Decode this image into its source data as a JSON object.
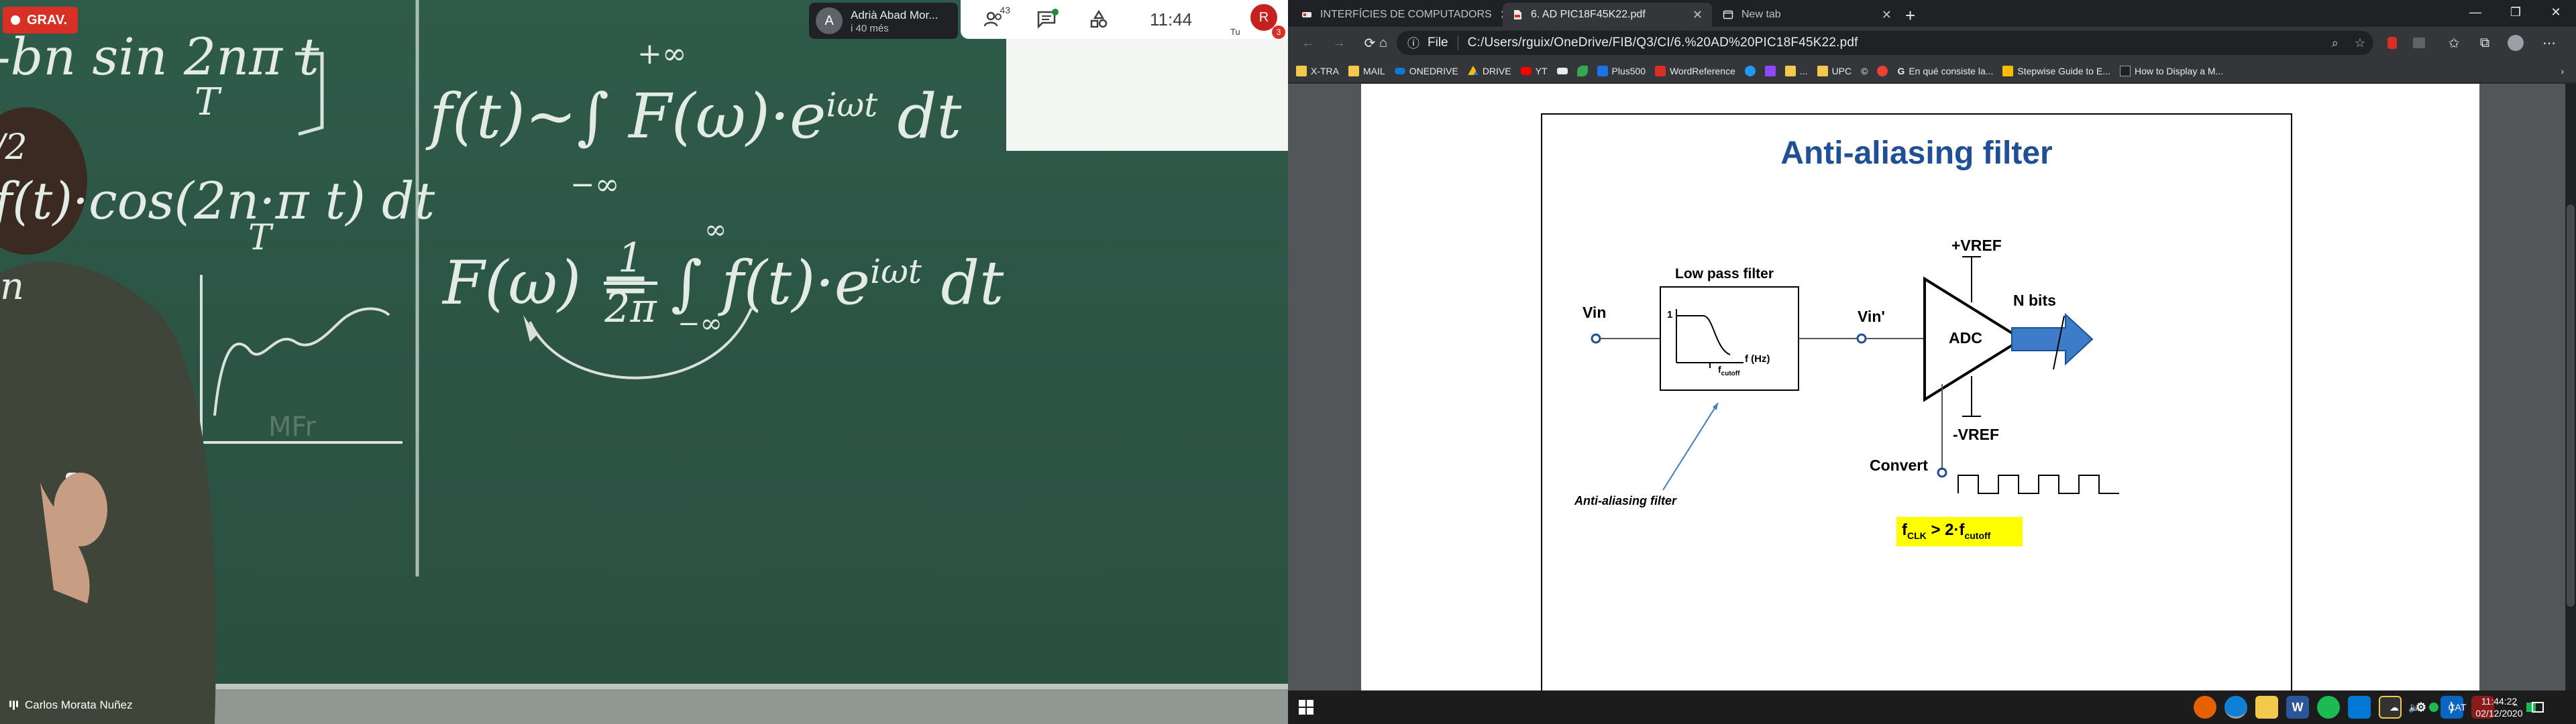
{
  "meet": {
    "rec_label": "GRAV.",
    "participant": {
      "initial": "A",
      "name": "Adrià Abad Mor...",
      "more": "i 40 més"
    },
    "people_count": "43",
    "time": "11:44",
    "self_initial": "R",
    "self_label": "Tu",
    "self_badge": "3",
    "presenter_name": "Carlos Morata Nuñez",
    "board": {
      "line1": "f(t)~∫ F(ω)·e",
      "line1_exp": "iωt",
      "line1_end": "dt",
      "line1_upper": "+∞",
      "line1_lower": "−∞",
      "line2_lhs": "F(ω) =",
      "line2_frac_num": "1",
      "line2_frac_den": "2π",
      "line2_int": "∫ f(t)·e",
      "line2_exp": "iωt",
      "line2_end": "dt",
      "line2_upper": "∞",
      "line2_lower": "−∞",
      "left_top": "-bn sin 2nπ t",
      "left_top_den": "T",
      "left_mid": "f(t)·cos(2n·π t) dt",
      "left_mid_den": "T",
      "left_frag_a": "/2",
      "left_frag_b": "n"
    }
  },
  "browser": {
    "tabs": [
      {
        "label": "INTERFÍCIES DE COMPUTADORS",
        "icon": "app-icon",
        "active": false
      },
      {
        "label": "6. AD PIC18F45K22.pdf",
        "icon": "pdf-icon",
        "active": true
      },
      {
        "label": "New tab",
        "icon": "newtab-icon",
        "active": false
      }
    ],
    "protocol": "File",
    "url": "C:/Users/rguix/OneDrive/FIB/Q3/CI/6.%20AD%20PIC18F45K22.pdf",
    "bookmarks": [
      "X-TRA",
      "MAIL",
      "ONEDRIVE",
      "DRIVE",
      "YT",
      "",
      "",
      "Plus500",
      "WordReference",
      "",
      "",
      "...",
      "UPC",
      "",
      "",
      "En qué consiste la...",
      "Stepwise Guide to E...",
      "How to Display a M..."
    ]
  },
  "slide": {
    "title": "Anti-aliasing filter",
    "vin": "Vin",
    "lpf_title": "Low pass filter",
    "lpf_one": "1",
    "lpf_axis": "f (Hz)",
    "lpf_fc": "f",
    "lpf_fc_sub": "cutoff",
    "vin_prime": "Vin'",
    "vref_pos": "+VREF",
    "vref_neg": "-VREF",
    "adc": "ADC",
    "nbits": "N bits",
    "convert": "Convert",
    "aa_label": "Anti-aliasing filter",
    "cond_f": "f",
    "cond_clk": "CLK",
    "cond_mid": "> 2·f",
    "cond_cutoff": "cutoff",
    "highlight_color": "#ffff00",
    "title_color": "#1f4f96",
    "arrow_color": "#3d7cc9"
  },
  "taskbar": {
    "time": "11:44:22",
    "date": "02/12/2020",
    "lang": "CAT",
    "apps": [
      "firefox-icon",
      "edge-icon",
      "explorer-icon",
      "word-icon",
      "spotify-icon",
      "rdp-icon",
      "notes-icon",
      "settings-icon",
      "vscode-icon",
      "app-red-icon"
    ]
  }
}
